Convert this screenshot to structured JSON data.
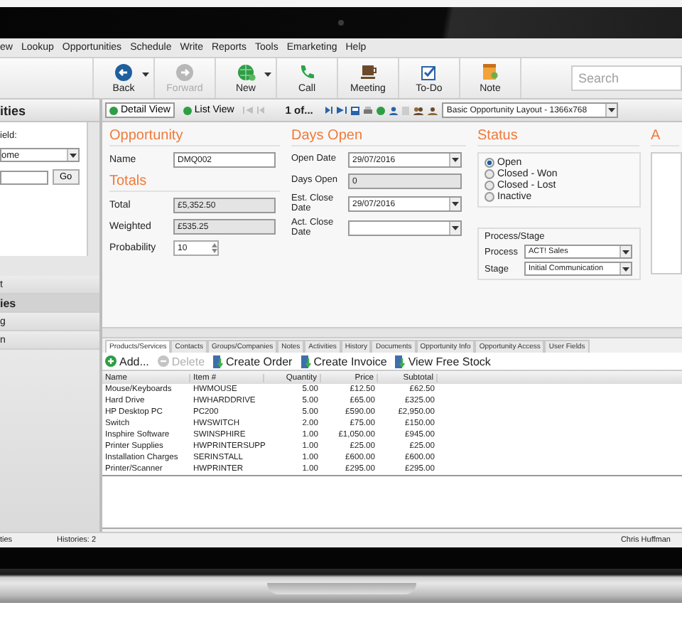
{
  "menu": [
    "ew",
    "Lookup",
    "Opportunities",
    "Schedule",
    "Write",
    "Reports",
    "Tools",
    "Emarketing",
    "Help"
  ],
  "toolbar": [
    {
      "label": "Back",
      "kind": "back",
      "disabled": false,
      "dropdown": true
    },
    {
      "label": "Forward",
      "kind": "forward",
      "disabled": true,
      "dropdown": false
    },
    {
      "label": "New",
      "kind": "new",
      "disabled": false,
      "dropdown": true
    },
    {
      "label": "Call",
      "kind": "call",
      "disabled": false,
      "dropdown": false
    },
    {
      "label": "Meeting",
      "kind": "meeting",
      "disabled": false,
      "dropdown": false
    },
    {
      "label": "To-Do",
      "kind": "todo",
      "disabled": false,
      "dropdown": false
    },
    {
      "label": "Note",
      "kind": "note",
      "disabled": false,
      "dropdown": false
    }
  ],
  "search": {
    "placeholder": "Search"
  },
  "side_panel": {
    "title": "ities",
    "field_label": "ield:",
    "dropdown_value": "ome",
    "go_button": "Go",
    "items": [
      {
        "label": "t",
        "selected": false
      },
      {
        "label": "ies",
        "selected": true
      },
      {
        "label": "g",
        "selected": false
      },
      {
        "label": "n",
        "selected": false
      }
    ]
  },
  "view_bar": {
    "views": [
      {
        "label": "Detail View",
        "selected": true
      },
      {
        "label": "List View",
        "selected": false
      }
    ],
    "record": "1 of...",
    "layout": "Basic Opportunity Layout - 1366x768"
  },
  "opportunity": {
    "heading": "Opportunity",
    "name_label": "Name",
    "name_value": "DMQ002"
  },
  "totals": {
    "heading": "Totals",
    "fields": [
      {
        "label": "Total",
        "value": "£5,352.50"
      },
      {
        "label": "Weighted",
        "value": "£535.25"
      }
    ],
    "probability_label": "Probability",
    "probability_value": "10"
  },
  "days_open": {
    "heading": "Days Open",
    "fields": [
      {
        "label": "Open Date",
        "value": "29/07/2016",
        "kind": "date"
      },
      {
        "label": "Days Open",
        "value": "0",
        "kind": "readonly"
      },
      {
        "label": "Est. Close Date",
        "value": "29/07/2016",
        "kind": "date"
      },
      {
        "label": "Act. Close Date",
        "kind": "date"
      }
    ]
  },
  "status": {
    "heading": "Status",
    "options": [
      {
        "label": "Open",
        "selected": true
      },
      {
        "label": "Closed - Won",
        "selected": false
      },
      {
        "label": "Closed - Lost",
        "selected": false
      },
      {
        "label": "Inactive",
        "selected": false
      }
    ],
    "process_group": "Process/Stage",
    "process_label": "Process",
    "process_value": "ACT! Sales",
    "stage_label": "Stage",
    "stage_value": "Initial Communication"
  },
  "cut_section": {
    "heading": "A"
  },
  "tabs": [
    {
      "label": "Products/Services",
      "selected": true
    },
    {
      "label": "Contacts",
      "selected": false
    },
    {
      "label": "Groups/Companies",
      "selected": false
    },
    {
      "label": "Notes",
      "selected": false
    },
    {
      "label": "Activities",
      "selected": false
    },
    {
      "label": "History",
      "selected": false
    },
    {
      "label": "Documents",
      "selected": false
    },
    {
      "label": "Opportunity Info",
      "selected": false
    },
    {
      "label": "Opportunity Access",
      "selected": false
    },
    {
      "label": "User Fields",
      "selected": false
    }
  ],
  "actions": [
    {
      "label": "Add...",
      "kind": "add",
      "disabled": false
    },
    {
      "label": "Delete",
      "kind": "delete",
      "disabled": true
    },
    {
      "label": "Create Order",
      "kind": "order",
      "disabled": false
    },
    {
      "label": "Create Invoice",
      "kind": "invoice",
      "disabled": false
    },
    {
      "label": "View Free Stock",
      "kind": "stock",
      "disabled": false
    }
  ],
  "table": {
    "columns": [
      "Name",
      "Item #",
      "Quantity",
      "Price",
      "Subtotal"
    ],
    "rows": [
      [
        "Mouse/Keyboards",
        "HWMOUSE",
        "5.00",
        "£12.50",
        "£62.50"
      ],
      [
        "Hard Drive",
        "HWHARDDRIVE",
        "5.00",
        "£65.00",
        "£325.00"
      ],
      [
        "HP Desktop PC",
        "PC200",
        "5.00",
        "£590.00",
        "£2,950.00"
      ],
      [
        "Switch",
        "HWSWITCH",
        "2.00",
        "£75.00",
        "£150.00"
      ],
      [
        "Insphire Software",
        "SWINSPHIRE",
        "1.00",
        "£1,050.00",
        "£945.00"
      ],
      [
        "Printer Supplies",
        "HWPRINTERSUPP",
        "1.00",
        "£25.00",
        "£25.00"
      ],
      [
        "Installation Charges",
        "SERINSTALL",
        "1.00",
        "£600.00",
        "£600.00"
      ],
      [
        "Printer/Scanner",
        "HWPRINTER",
        "1.00",
        "£295.00",
        "£295.00"
      ]
    ]
  },
  "status_bar": [
    "ties",
    "Histories: 2",
    "Chris Huffman"
  ]
}
